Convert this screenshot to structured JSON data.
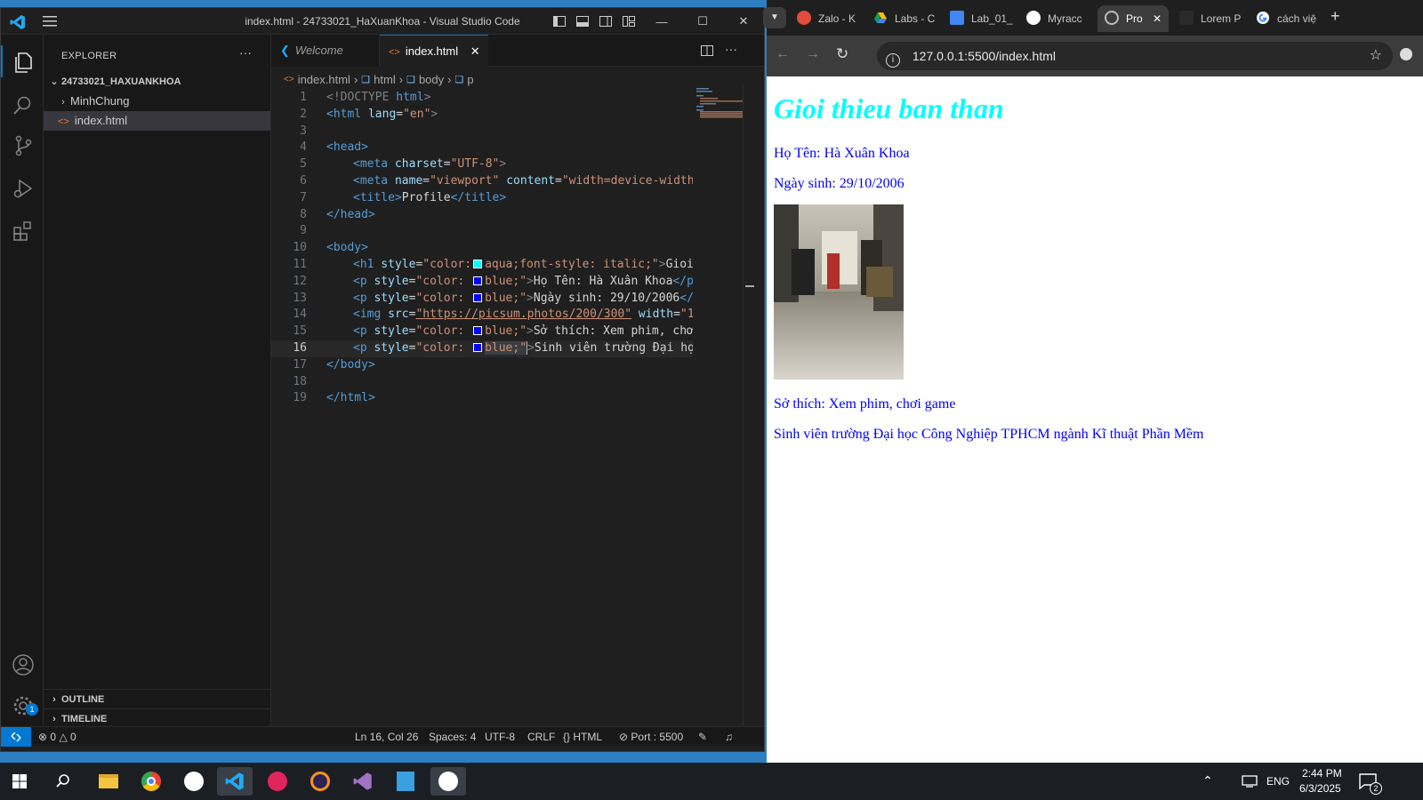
{
  "vscode": {
    "window_title": "index.html - 24733021_HaXuanKhoa - Visual Studio Code",
    "explorer": {
      "title": "EXPLORER",
      "more": "···",
      "folder": "24733021_HAXUANKHOA",
      "items": [
        {
          "label": "MinhChung",
          "type": "folder"
        },
        {
          "label": "index.html",
          "type": "file"
        }
      ],
      "outline": "OUTLINE",
      "timeline": "TIMELINE"
    },
    "tabs": [
      {
        "label": "Welcome"
      },
      {
        "label": "index.html"
      }
    ],
    "breadcrumb": {
      "file": "index.html",
      "html": "html",
      "body": "body",
      "p": "p"
    },
    "line_numbers": [
      "1",
      "2",
      "3",
      "4",
      "5",
      "6",
      "7",
      "8",
      "9",
      "10",
      "11",
      "12",
      "13",
      "14",
      "15",
      "16",
      "17",
      "18",
      "19"
    ],
    "code": {
      "l1_open": "<!DOCTYPE",
      "l1_kw": " html",
      "l1_close": ">",
      "l2_tag": "<html",
      "l2_attr": " lang",
      "l2_eq": "=",
      "l2_val": "\"en\"",
      "l2_close": ">",
      "l4": "<head>",
      "l5_tag": "<meta",
      "l5_attr": " charset",
      "l5_eq": "=",
      "l5_val": "\"UTF-8\"",
      "l5_close": ">",
      "l6_tag": "<meta",
      "l6_attr1": " name",
      "l6_eq1": "=",
      "l6_val1": "\"viewport\"",
      "l6_attr2": " content",
      "l6_eq2": "=",
      "l6_val2": "\"width=device-width",
      "l7_open": "<title>",
      "l7_text": "Profile",
      "l7_close": "</title>",
      "l8": "</head>",
      "l10": "<body>",
      "l11_tag": "<h1",
      "l11_attr": " style",
      "l11_eq": "=",
      "l11_val1": "\"color:",
      "l11_val2": "aqua;font-style: italic;\"",
      "l11_close": ">",
      "l11_text": "Gioi",
      "l12_tag": "<p",
      "l12_attr": " style",
      "l12_eq": "=",
      "l12_val1": "\"color: ",
      "l12_val2": "blue;\"",
      "l12_close": ">",
      "l12_text": "Họ Tên: Hà Xuân Khoa",
      "l12_end": "</p",
      "l13_tag": "<p",
      "l13_attr": " style",
      "l13_eq": "=",
      "l13_val1": "\"color: ",
      "l13_val2": "blue;\"",
      "l13_close": ">",
      "l13_text": "Ngày sinh: 29/10/2006",
      "l13_end": "</",
      "l14_tag": "<img",
      "l14_attr": " src",
      "l14_eq": "=",
      "l14_val": "\"https://picsum.photos/200/300\"",
      "l14_attr2": " width",
      "l14_eq2": "=",
      "l14_val2": "\"1",
      "l15_tag": "<p",
      "l15_attr": " style",
      "l15_eq": "=",
      "l15_val1": "\"color: ",
      "l15_val2": "blue;\"",
      "l15_close": ">",
      "l15_text": "Sở thích: Xem phim, chơ",
      "l16_tag": "<p",
      "l16_attr": " style",
      "l16_eq": "=",
      "l16_val1": "\"color: ",
      "l16_val2": "blue;\"",
      "l16_close": ">",
      "l16_text": "Sinh viên trường Đại họ",
      "l17": "</body>",
      "l19": "</html>"
    },
    "status": {
      "errors": "0",
      "warnings": "0",
      "position": "Ln 16, Col 26",
      "spaces": "Spaces: 4",
      "encoding": "UTF-8",
      "eol": "CRLF",
      "language": "HTML",
      "port": "Port : 5500",
      "badge": "1"
    }
  },
  "browser": {
    "tabs": [
      {
        "label": "Zalo - K"
      },
      {
        "label": "Labs - C"
      },
      {
        "label": "Lab_01_"
      },
      {
        "label": "Myracc"
      },
      {
        "label": "Pro"
      },
      {
        "label": "Lorem P"
      },
      {
        "label": "cách việ"
      }
    ],
    "url": "127.0.0.1:5500/index.html",
    "page": {
      "heading": "Gioi thieu ban than",
      "name": "Họ Tên: Hà Xuân Khoa",
      "dob": "Ngày sinh: 29/10/2006",
      "hobby": "Sở thích: Xem phim, chơi game",
      "school": "Sinh viên trường Đại học Công Nghiệp TPHCM ngành Kĩ thuật Phần Mềm"
    }
  },
  "taskbar": {
    "lang": "ENG",
    "time": "2:44 PM",
    "date": "6/3/2025",
    "notif": "2"
  },
  "colors": {
    "vscode_accent": "#0078d4",
    "heading_color": "#00ffff",
    "text_color": "#0000ff"
  }
}
